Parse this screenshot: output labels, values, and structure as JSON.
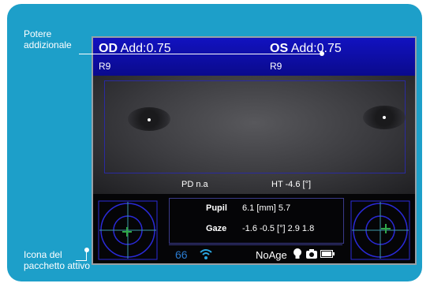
{
  "callouts": {
    "top_line1": "Potere",
    "top_line2": "addizionale",
    "bottom_line1": "Icona del",
    "bottom_line2": "pacchetto attivo"
  },
  "header": {
    "od_eye": "OD",
    "od_add": "Add:0.75",
    "os_eye": "OS",
    "os_add": "Add:0.75",
    "od_sub": "R9",
    "os_sub": "R9"
  },
  "measurements": {
    "pd": "PD n.a",
    "ht": "HT -4.6 [°]"
  },
  "table": {
    "pupil_label": "Pupil",
    "pupil_value": "6.1 [mm] 5.7",
    "gaze_label": "Gaze",
    "gaze_value": "-1.6  -0.5 [°] 2.9  1.8"
  },
  "status": {
    "package_number": "66",
    "age_text": "NoAge",
    "icons": [
      "wifi-icon",
      "bulb-icon",
      "camera-icon",
      "battery-icon"
    ]
  },
  "colors": {
    "panel": "#1d9fc9",
    "header_bar": "#1212c0",
    "target_ring": "#2a2ad8",
    "crosshair": "#2fa84a",
    "package_number": "#2a7bd0"
  }
}
